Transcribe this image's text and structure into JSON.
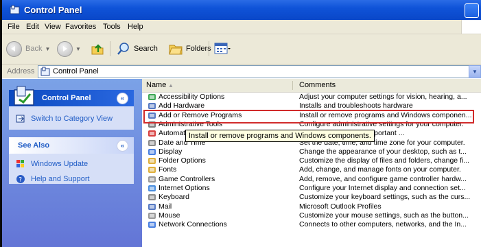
{
  "window": {
    "title": "Control Panel"
  },
  "menu": [
    "File",
    "Edit",
    "View",
    "Favorites",
    "Tools",
    "Help"
  ],
  "toolbar": {
    "back": "Back",
    "search": "Search",
    "folders": "Folders"
  },
  "address": {
    "label": "Address",
    "value": "Control Panel"
  },
  "sidebar": {
    "control_panel": {
      "title": "Control Panel",
      "link": "Switch to Category View"
    },
    "see_also": {
      "title": "See Also",
      "items": [
        "Windows Update",
        "Help and Support"
      ]
    }
  },
  "list": {
    "columns": {
      "name": "Name",
      "comments": "Comments"
    },
    "rows": [
      {
        "name": "Accessibility Options",
        "comment": "Adjust your computer settings for vision, hearing, a...",
        "icon": "accessibility-icon"
      },
      {
        "name": "Add Hardware",
        "comment": "Installs and troubleshoots hardware",
        "icon": "add-hardware-icon"
      },
      {
        "name": "Add or Remove Programs",
        "comment": "Install or remove programs and Windows componen...",
        "icon": "add-remove-programs-icon"
      },
      {
        "name": "Administrative Tools",
        "comment": "Configure administrative settings for your computer.",
        "icon": "admin-tools-icon"
      },
      {
        "name": "Automatic Updates",
        "comment": "automatically deliver important ...",
        "icon": "automatic-updates-icon"
      },
      {
        "name": "Date and Time",
        "comment": "Set the date, time, and time zone for your computer.",
        "icon": "date-time-icon"
      },
      {
        "name": "Display",
        "comment": "Change the appearance of your desktop, such as t...",
        "icon": "display-icon"
      },
      {
        "name": "Folder Options",
        "comment": "Customize the display of files and folders, change fi...",
        "icon": "folder-options-icon"
      },
      {
        "name": "Fonts",
        "comment": "Add, change, and manage fonts on your computer.",
        "icon": "fonts-icon"
      },
      {
        "name": "Game Controllers",
        "comment": "Add, remove, and configure game controller hardw...",
        "icon": "game-controllers-icon"
      },
      {
        "name": "Internet Options",
        "comment": "Configure your Internet display and connection set...",
        "icon": "internet-options-icon"
      },
      {
        "name": "Keyboard",
        "comment": "Customize your keyboard settings, such as the curs...",
        "icon": "keyboard-icon"
      },
      {
        "name": "Mail",
        "comment": "Microsoft Outlook Profiles",
        "icon": "mail-icon"
      },
      {
        "name": "Mouse",
        "comment": "Customize your mouse settings, such as the button...",
        "icon": "mouse-icon"
      },
      {
        "name": "Network Connections",
        "comment": "Connects to other computers, networks, and the In...",
        "icon": "network-connections-icon"
      }
    ]
  },
  "tooltip": "Install or remove programs and Windows components."
}
